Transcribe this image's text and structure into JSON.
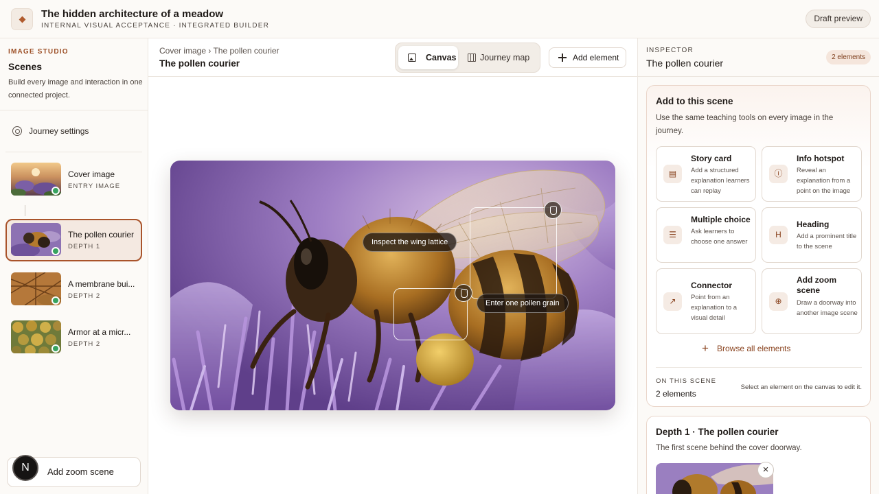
{
  "header": {
    "title": "The hidden architecture of a meadow",
    "subtitle": "INTERNAL VISUAL ACCEPTANCE · INTEGRATED BUILDER",
    "draft_button": "Draft preview",
    "logo_icon": "diamond-icon"
  },
  "sidebar": {
    "section_label": "IMAGE STUDIO",
    "title": "Scenes",
    "description": "Build every image and interaction in one connected project.",
    "journey_settings": "Journey settings",
    "scenes": [
      {
        "name": "Cover image",
        "depth": "ENTRY IMAGE",
        "status": "ready"
      },
      {
        "name": "The pollen courier",
        "depth": "DEPTH 1",
        "status": "ready",
        "active": true
      },
      {
        "name": "A membrane bui...",
        "depth": "DEPTH 2",
        "status": "ready"
      },
      {
        "name": "Armor at a micr...",
        "depth": "DEPTH 2",
        "status": "ready"
      }
    ],
    "add_zoom_scene": "Add zoom scene",
    "avatar_initial": "N"
  },
  "center": {
    "breadcrumb": "Cover image › The pollen courier",
    "title": "The pollen courier",
    "tabs": [
      {
        "label": "Canvas",
        "icon": "image-icon",
        "active": true
      },
      {
        "label": "Journey map",
        "icon": "map-icon",
        "active": false
      }
    ],
    "add_element": "Add element",
    "hotspots": [
      {
        "label": "Inspect the wing lattice"
      },
      {
        "label": "Enter one pollen grain"
      }
    ]
  },
  "inspector": {
    "label": "INSPECTOR",
    "title": "The pollen courier",
    "badge": "2 elements",
    "add_card": {
      "title": "Add to this scene",
      "description": "Use the same teaching tools on every image in the journey.",
      "tools": [
        {
          "name": "Story card",
          "desc": "Add a structured explanation learners can replay",
          "icon": "book-icon"
        },
        {
          "name": "Info hotspot",
          "desc": "Reveal an explanation from a point on the image",
          "icon": "info-icon"
        },
        {
          "name": "Multiple choice",
          "desc": "Ask learners to choose one answer",
          "icon": "list-check-icon"
        },
        {
          "name": "Heading",
          "desc": "Add a prominent title to the scene",
          "icon": "heading-icon"
        },
        {
          "name": "Connector",
          "desc": "Point from an explanation to a visual detail",
          "icon": "connector-icon"
        },
        {
          "name": "Add zoom scene",
          "desc": "Draw a doorway into another image scene",
          "icon": "zoom-in-icon"
        }
      ],
      "browse": "Browse all elements",
      "on_scene_label": "ON THIS SCENE",
      "on_scene_count": "2 elements",
      "on_scene_hint": "Select an element on the canvas to edit it."
    },
    "depth_card": {
      "title": "Depth 1 · The pollen courier",
      "description": "The first scene behind the cover doorway."
    }
  },
  "colors": {
    "accent": "#a9532a",
    "status_ready": "#37a35f",
    "panel_bg": "#fcfaf7"
  }
}
